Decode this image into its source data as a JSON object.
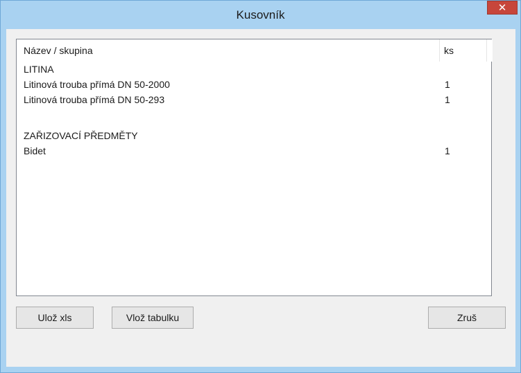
{
  "window": {
    "title": "Kusovník",
    "close_glyph": "✕"
  },
  "table": {
    "columns": [
      "Název / skupina",
      "ks"
    ],
    "rows": [
      {
        "name": "LITINA",
        "ks": ""
      },
      {
        "name": "Litinová trouba přímá DN 50-2000",
        "ks": "1"
      },
      {
        "name": "Litinová trouba přímá DN 50-293",
        "ks": "1"
      },
      {
        "name": "",
        "ks": ""
      },
      {
        "name": "ZAŘIZOVACÍ PŘEDMĚTY",
        "ks": ""
      },
      {
        "name": "Bidet",
        "ks": "1"
      }
    ]
  },
  "buttons": {
    "save_xls": "Ulož xls",
    "insert_table": "Vlož tabulku",
    "cancel": "Zruš"
  },
  "colors": {
    "titlebar": "#a9d2f1",
    "close": "#c7463b",
    "dialog_bg": "#f0f0f0"
  }
}
